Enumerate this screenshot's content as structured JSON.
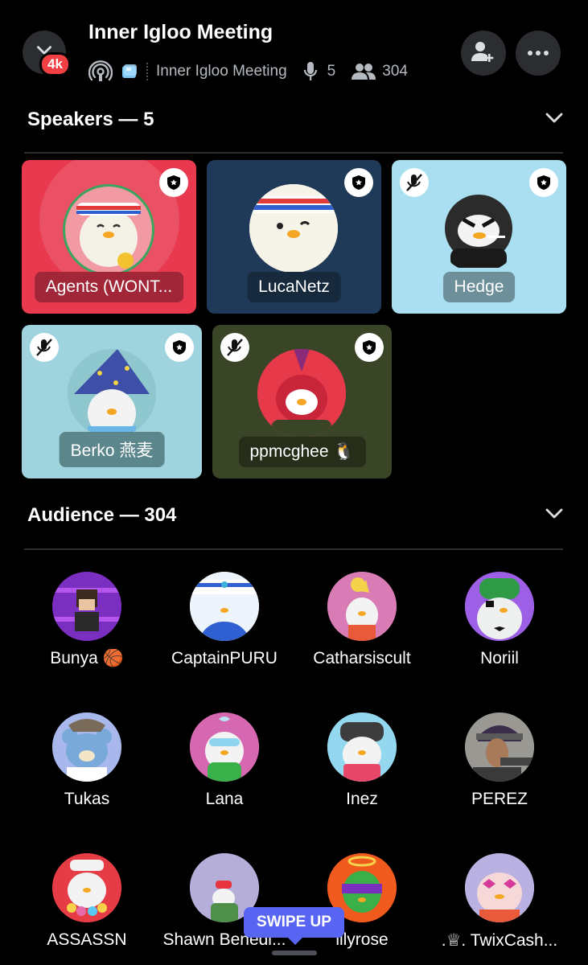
{
  "header": {
    "title": "Inner Igloo Meeting",
    "badge": "4k",
    "channel_name": "Inner Igloo Meeting",
    "speaker_count": "5",
    "listener_count": "304"
  },
  "speakers": {
    "label": "Speakers — 5",
    "items": [
      {
        "name": "Agents (WONT...",
        "bg": "#e8394f",
        "muted": false,
        "speaking": true
      },
      {
        "name": "LucaNetz",
        "bg": "#1f3a58",
        "muted": false,
        "speaking": false
      },
      {
        "name": "Hedge",
        "bg": "#a9dff0",
        "muted": true,
        "speaking": false
      },
      {
        "name": "Berko 燕麦",
        "bg": "#9fd3de",
        "muted": true,
        "speaking": false
      },
      {
        "name": "ppmcghee 🐧",
        "bg": "#3a4528",
        "muted": true,
        "speaking": false
      }
    ]
  },
  "audience": {
    "label": "Audience — 304",
    "items": [
      {
        "name": "Bunya 🏀"
      },
      {
        "name": "CaptainPURU"
      },
      {
        "name": "Catharsiscult"
      },
      {
        "name": "Noriil"
      },
      {
        "name": "Tukas"
      },
      {
        "name": "Lana"
      },
      {
        "name": "Inez"
      },
      {
        "name": "PEREZ"
      },
      {
        "name": "ASSASSN"
      },
      {
        "name": "Shawn Benedi..."
      },
      {
        "name": "lilyrose"
      },
      {
        "name": ".♕. TwixCash..."
      }
    ]
  },
  "swipe_hint": "SWIPE UP",
  "colors": {
    "accent": "#5865f2",
    "badge_red": "#f23f43",
    "speaking_ring": "#3ba55d"
  }
}
